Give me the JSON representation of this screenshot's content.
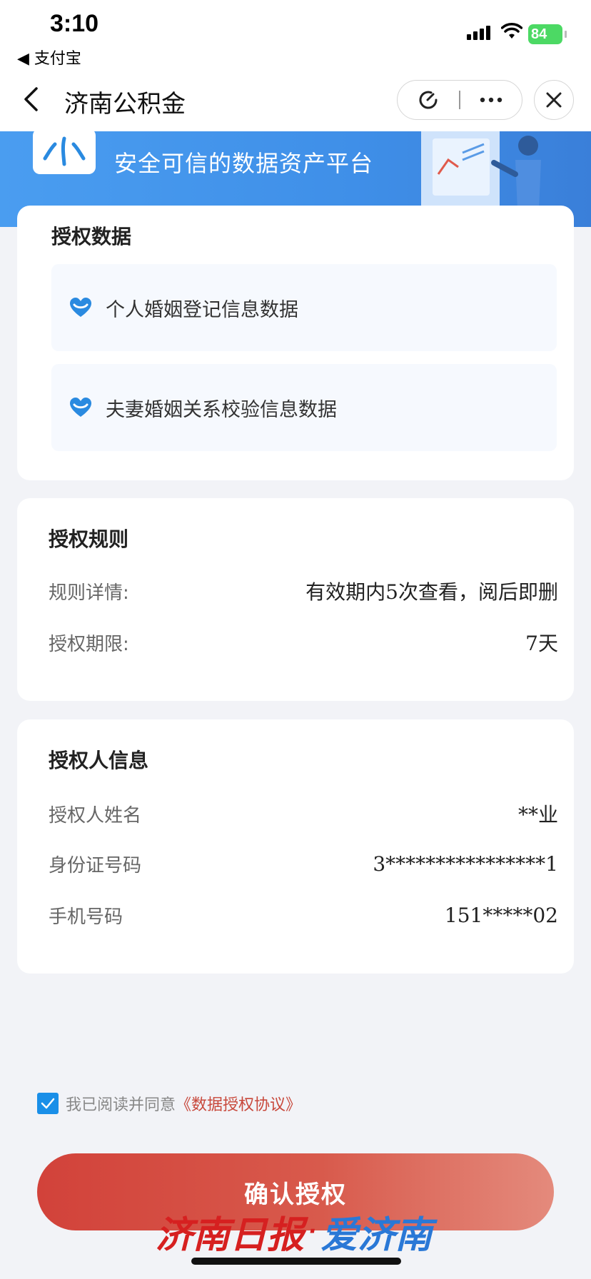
{
  "status_bar": {
    "time": "3:10",
    "back_app": "◀ 支付宝",
    "battery": "84",
    "battery_color": "#4cd964"
  },
  "nav": {
    "title": "济南公积金",
    "icons": [
      "back-arrow-icon",
      "refresh-icon",
      "more-icon",
      "close-icon"
    ]
  },
  "banner": {
    "slogan": "安全可信的数据资产平台"
  },
  "auth_data": {
    "title": "授权数据",
    "items": [
      {
        "label": "个人婚姻登记信息数据"
      },
      {
        "label": "夫妻婚姻关系校验信息数据"
      }
    ]
  },
  "auth_rules": {
    "title": "授权规则",
    "rows": [
      {
        "label": "规则详情:",
        "value": "有效期内5次查看，阅后即删"
      },
      {
        "label": "授权期限:",
        "value": "7天"
      }
    ]
  },
  "authorizer": {
    "title": "授权人信息",
    "rows": [
      {
        "label": "授权人姓名",
        "value": "**业"
      },
      {
        "label": "身份证号码",
        "value": "3****************1"
      },
      {
        "label": "手机号码",
        "value": "151*****02"
      }
    ]
  },
  "agreement": {
    "checked": true,
    "text": "我已阅读并同意",
    "link": "《数据授权协议》"
  },
  "confirm_button": {
    "label": "确认授权",
    "color": "#d2423a"
  },
  "watermark": {
    "part1": "济南日报",
    "dot": "·",
    "part2": "爱济南"
  }
}
